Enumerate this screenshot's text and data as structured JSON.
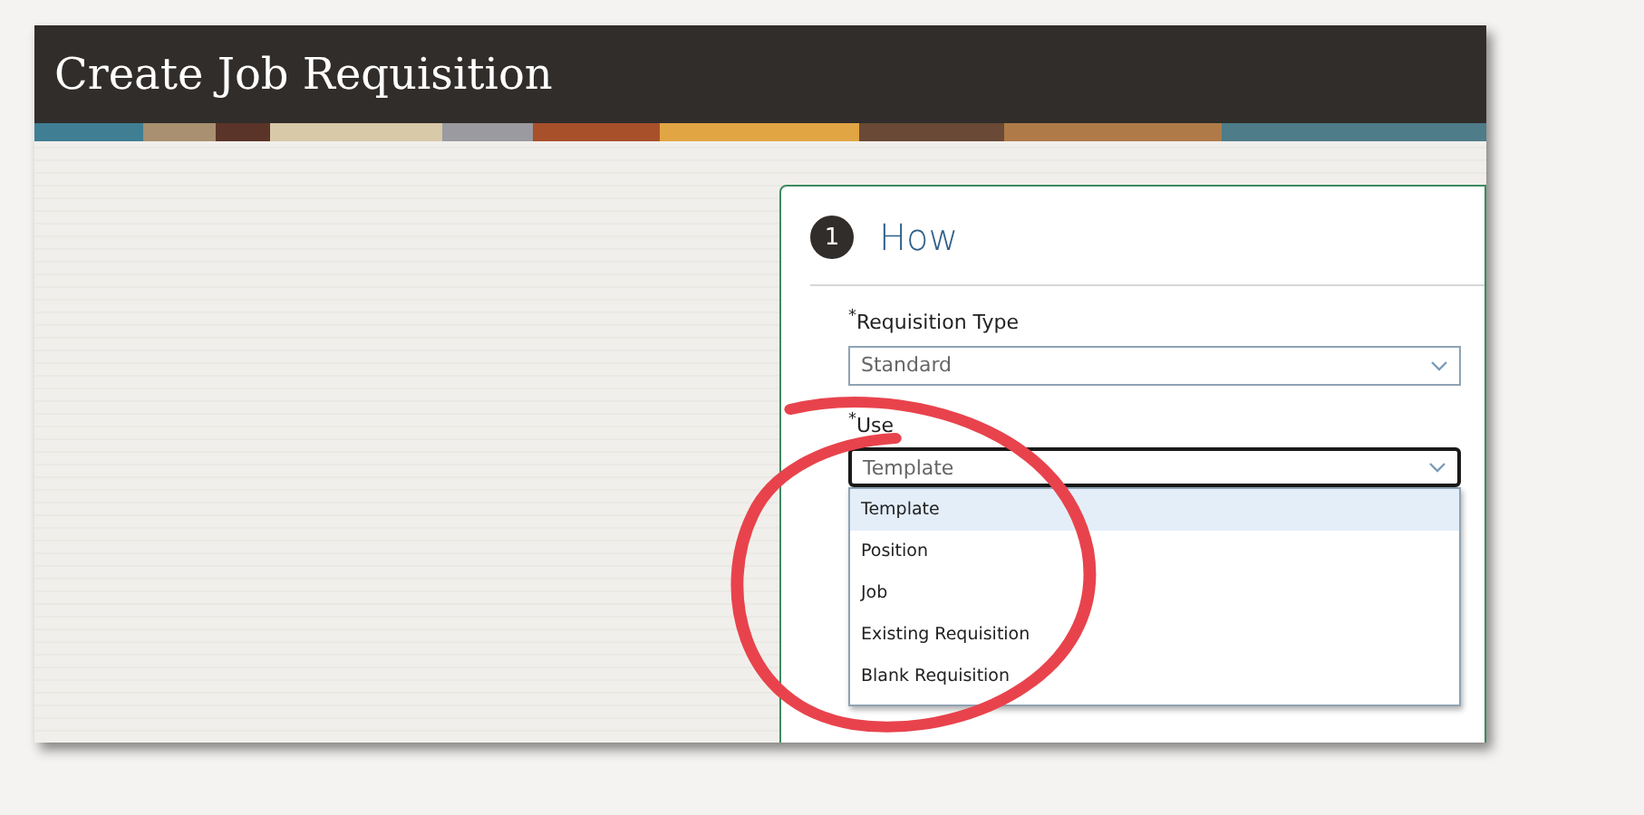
{
  "window": {
    "title": "Create Job Requisition"
  },
  "step": {
    "number": "1",
    "title": "How"
  },
  "fields": [
    {
      "label": "$^{*}$Requisition Type",
      "value": "Standard",
      "focused": false
    },
    {
      "label": "$^{*}$Use",
      "value": "Template",
      "focused": true,
      "expanded": true
    }
  ],
  "dropdown": {
    "options": [
      {
        "label": "Template",
        "selected": true
      },
      {
        "label": "Position",
        "selected": false
      },
      {
        "label": "Job",
        "selected": false
      },
      {
        "label": "Existing Requisition",
        "selected": false
      },
      {
        "label": "Blank Requisition",
        "selected": false
      }
    ]
  }
}
